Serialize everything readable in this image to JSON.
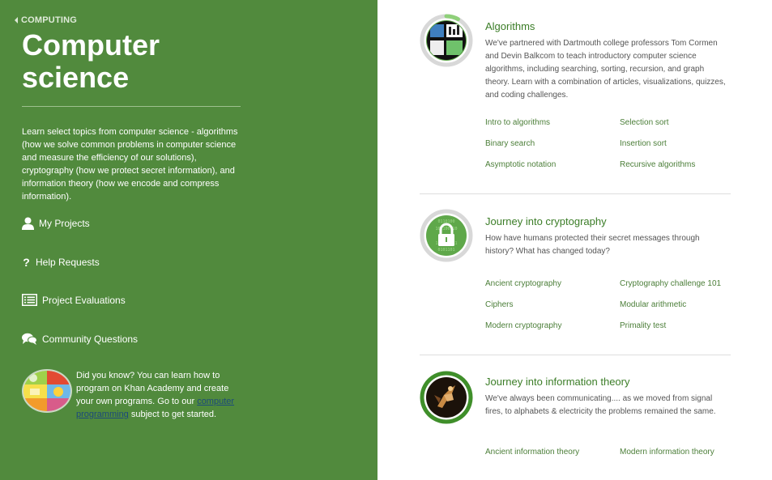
{
  "sidebar": {
    "breadcrumb": "COMPUTING",
    "title_line1": "Computer",
    "title_line2": "science",
    "description": "Learn select topics from computer science - algorithms (how we solve common problems in computer science and measure the efficiency of our solutions), cryptography (how we protect secret information), and information theory (how we encode and compress information).",
    "nav": [
      {
        "label": "My Projects",
        "icon": "user-icon"
      },
      {
        "label": "Help Requests",
        "icon": "question-icon"
      },
      {
        "label": "Project Evaluations",
        "icon": "list-icon"
      },
      {
        "label": "Community Questions",
        "icon": "chat-bubbles-icon"
      }
    ],
    "promo": {
      "text_before": "Did you know? You can learn how to program on Khan Academy and create your own programs. Go to our ",
      "link": "computer programming",
      "text_after": " subject to get started."
    }
  },
  "topics": [
    {
      "title": "Algorithms",
      "description": "We've partnered with Dartmouth college professors Tom Cormen and Devin Balkcom to teach introductory computer science algorithms, including searching, sorting, recursion, and graph theory. Learn with a combination of articles, visualizations, quizzes, and coding challenges.",
      "progress": 0.08,
      "links": [
        "Intro to algorithms",
        "Selection sort",
        "Binary search",
        "Insertion sort",
        "Asymptotic notation",
        "Recursive algorithms"
      ]
    },
    {
      "title": "Journey into cryptography",
      "description": "How have humans protected their secret messages through history? What has changed today?",
      "progress": 0,
      "links": [
        "Ancient cryptography",
        "Cryptography challenge 101",
        "Ciphers",
        "Modular arithmetic",
        "Modern cryptography",
        "Primality test"
      ]
    },
    {
      "title": "Journey into information theory",
      "description": "We've always been communicating.... as we moved from signal fires, to alphabets & electricity the problems remained the same.",
      "progress": 1,
      "links": [
        "Ancient information theory",
        "Modern information theory"
      ]
    }
  ],
  "colors": {
    "sidebar": "#518a3d",
    "accent": "#3b7d27",
    "link": "#4b7e38"
  }
}
